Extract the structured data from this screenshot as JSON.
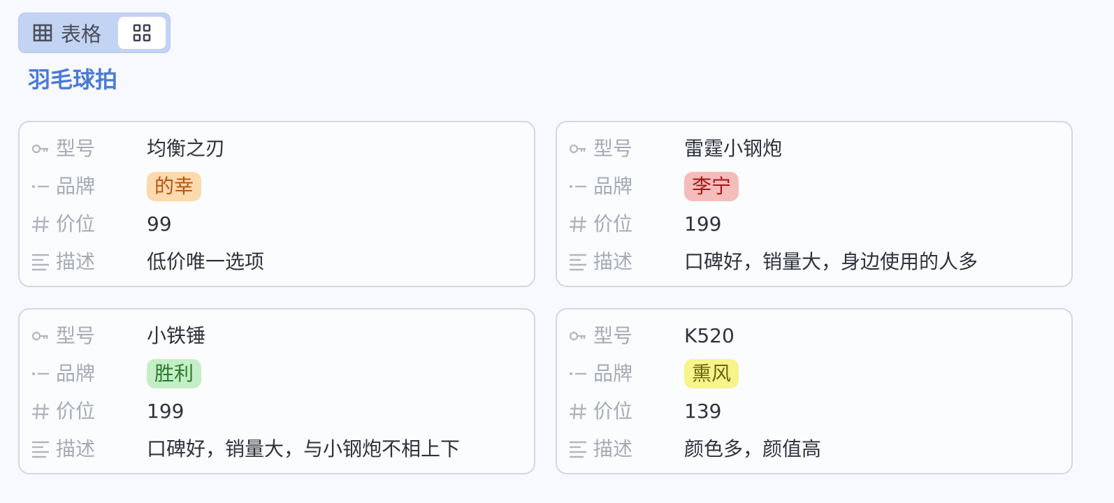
{
  "view_switch": {
    "table_label": "表格",
    "table_icon": "table-grid-icon",
    "gallery_icon": "gallery-grid-icon"
  },
  "title": "羽毛球拍",
  "fields": {
    "model": "型号",
    "brand": "品牌",
    "price": "价位",
    "desc": "描述"
  },
  "cards": [
    {
      "model": "均衡之刃",
      "brand": "的幸",
      "brand_bg": "#fdd9ae",
      "brand_fg": "#b5560f",
      "price": "99",
      "desc": "低价唯一选项"
    },
    {
      "model": "雷霆小钢炮",
      "brand": "李宁",
      "brand_bg": "#f5bcbc",
      "brand_fg": "#a31717",
      "price": "199",
      "desc": "口碑好，销量大，身边使用的人多"
    },
    {
      "model": "小铁锤",
      "brand": "胜利",
      "brand_bg": "#c4eec5",
      "brand_fg": "#2b7a2e",
      "price": "199",
      "desc": "口碑好，销量大，与小钢炮不相上下"
    },
    {
      "model": "K520",
      "brand": "熏风",
      "brand_bg": "#f6f48a",
      "brand_fg": "#6b6510",
      "price": "139",
      "desc": "颜色多，颜值高"
    }
  ]
}
